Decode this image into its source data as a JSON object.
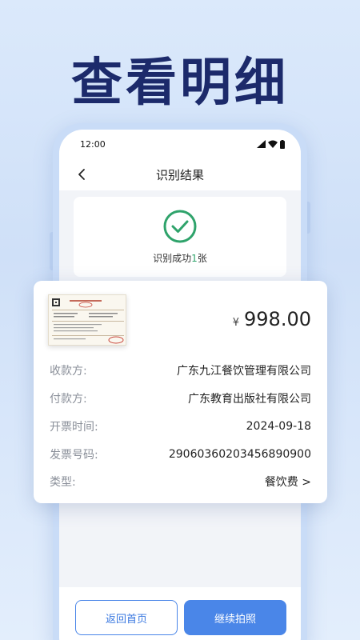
{
  "headline": "查看明细",
  "status_bar": {
    "time": "12:00"
  },
  "nav": {
    "title": "识别结果"
  },
  "success": {
    "prefix": "识别成功",
    "count": "1",
    "suffix": "张"
  },
  "detail": {
    "currency": "¥",
    "amount": "998.00",
    "rows": [
      {
        "label": "收款方:",
        "value": "广东九江餐饮管理有限公司"
      },
      {
        "label": "付款方:",
        "value": "广东教育出版社有限公司"
      },
      {
        "label": "开票时间:",
        "value": "2024-09-18"
      },
      {
        "label": "发票号码:",
        "value": "29060360203456890900"
      },
      {
        "label": "类型:",
        "value": "餐饮费 >"
      }
    ]
  },
  "buttons": {
    "home": "返回首页",
    "continue": "继续拍照"
  },
  "colors": {
    "accent": "#4a86e8",
    "success": "#2fa36b",
    "headline": "#1c2a6b"
  },
  "icons": [
    "back-icon",
    "check-circle-icon",
    "signal-icon",
    "wifi-icon",
    "battery-icon",
    "invoice-thumbnail"
  ]
}
